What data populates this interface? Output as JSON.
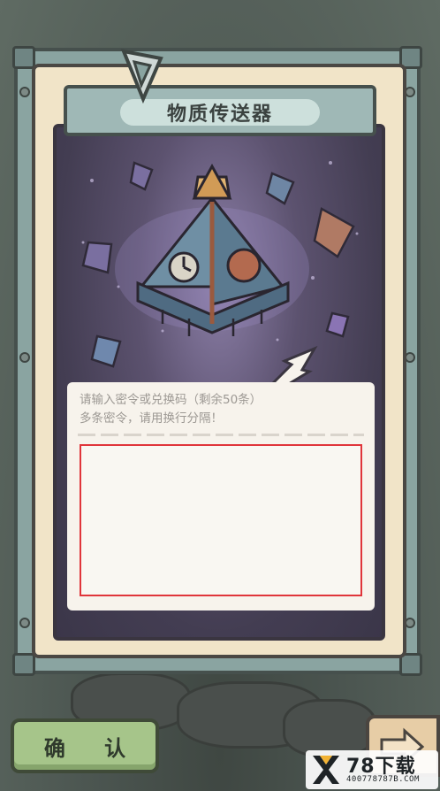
{
  "dialog": {
    "title": "物质传送器",
    "prompt_line1": "请输入密令或兑换码（剩余50条）",
    "prompt_line2": "多条密令，请用换行分隔！",
    "input_value": ""
  },
  "buttons": {
    "confirm_label": "确 认"
  },
  "watermark": {
    "brand": "78下载",
    "domain": "400778787B.COM"
  },
  "colors": {
    "frame": "#8aa4a1",
    "panel": "#f1e4c8",
    "screen": "#433d52",
    "input_border": "#e0353b",
    "confirm_bg": "#a6c58a",
    "watermark_accent": "#f2b233"
  },
  "icons": [
    "hook-icon",
    "pyramid-teleporter-icon",
    "crystal-icon",
    "next-arrow-icon"
  ]
}
